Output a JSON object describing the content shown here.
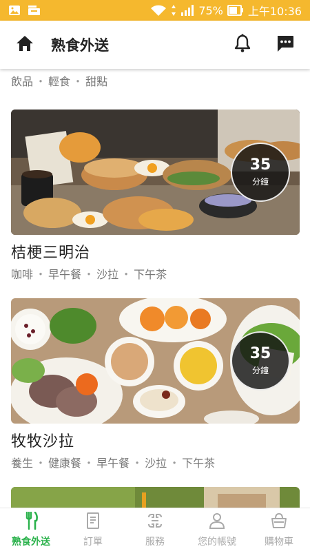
{
  "status_bar": {
    "battery": "75%",
    "time": "上午10:36",
    "colors": {
      "background": "#f5b82e"
    }
  },
  "header": {
    "title": "熟食外送",
    "icons": {
      "home": "home-icon",
      "bell": "bell-icon",
      "chat": "chat-icon"
    }
  },
  "partial_card": {
    "tags": [
      "飲品",
      "輕食",
      "甜點"
    ]
  },
  "cards": [
    {
      "title": "桔梗三明治",
      "tags": [
        "咖啡",
        "早午餐",
        "沙拉",
        "下午茶"
      ],
      "time_value": "35",
      "time_unit": "分鐘"
    },
    {
      "title": "牧牧沙拉",
      "tags": [
        "養生",
        "健康餐",
        "早午餐",
        "沙拉",
        "下午茶"
      ],
      "time_value": "35",
      "time_unit": "分鐘"
    }
  ],
  "tag_separator": "・",
  "bottom_nav": {
    "items": [
      {
        "label": "熟食外送",
        "icon": "fork-knife-icon",
        "active": true
      },
      {
        "label": "訂單",
        "icon": "receipt-icon",
        "active": false
      },
      {
        "label": "服務",
        "icon": "service-icon",
        "active": false
      },
      {
        "label": "您的帳號",
        "icon": "user-icon",
        "active": false
      },
      {
        "label": "購物車",
        "icon": "basket-icon",
        "active": false
      }
    ],
    "colors": {
      "active": "#2bb24c",
      "inactive": "#aaaaaa"
    }
  }
}
